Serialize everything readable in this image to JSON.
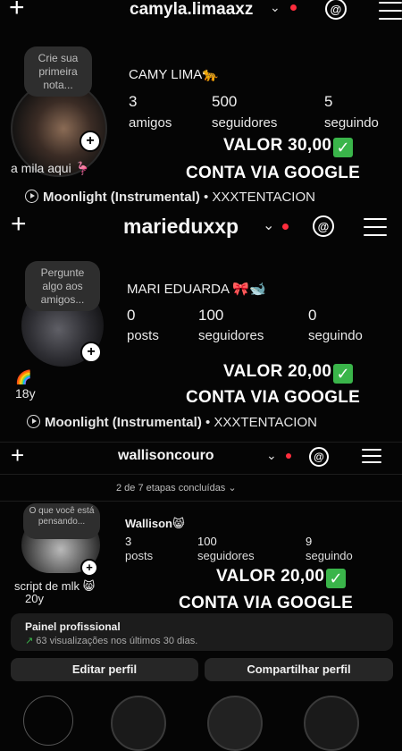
{
  "s1": {
    "username": "camyla.limaaxz",
    "note": "Crie sua primeira nota...",
    "display_name": "CAMY LIMA🐆",
    "stats": [
      {
        "num": "3",
        "label": "amigos"
      },
      {
        "num": "500",
        "label": "seguidores"
      },
      {
        "num": "5",
        "label": "seguindo"
      }
    ],
    "bio": "a mila aqui 🦩",
    "promo_price": "VALOR 30,00",
    "promo_account": "CONTA VIA GOOGLE",
    "music_title": "Moonlight (Instrumental)",
    "music_artist": " • XXXTENTACION"
  },
  "s2": {
    "username": "marieduxxp",
    "note": "Pergunte algo aos amigos...",
    "display_name": "MARI EDUARDA 🎀🐋",
    "stats": [
      {
        "num": "0",
        "label": "posts"
      },
      {
        "num": "100",
        "label": "seguidores"
      },
      {
        "num": "0",
        "label": "seguindo"
      }
    ],
    "bio_line1": "🌈",
    "bio_line2": "18y",
    "promo_price": "VALOR 20,00",
    "promo_account": "CONTA VIA GOOGLE",
    "music_title": "Moonlight (Instrumental)",
    "music_artist": " • XXXTENTACION"
  },
  "s3": {
    "username": "wallisoncouro",
    "steps": "2 de 7 etapas concluídas",
    "note": "O que você está pensando...",
    "display_name": "Wallison😸",
    "stats": [
      {
        "num": "3",
        "label": "posts"
      },
      {
        "num": "100",
        "label": "seguidores"
      },
      {
        "num": "9",
        "label": "seguindo"
      }
    ],
    "bio_line1": "script de mlk 😸",
    "bio_line2": "20y",
    "promo_price": "VALOR 20,00",
    "promo_account": "CONTA VIA GOOGLE",
    "panel_title": "Painel profissional",
    "panel_sub": "63 visualizações nos últimos 30 dias.",
    "edit_btn": "Editar perfil",
    "share_btn": "Compartilhar perfil"
  },
  "icons": {
    "check": "✓",
    "plus": "+",
    "threads": "@",
    "chevron": "⌄",
    "trend": "↗"
  },
  "colors": {
    "accent_red": "#ff2d3d",
    "check_green": "#3ab54a"
  }
}
